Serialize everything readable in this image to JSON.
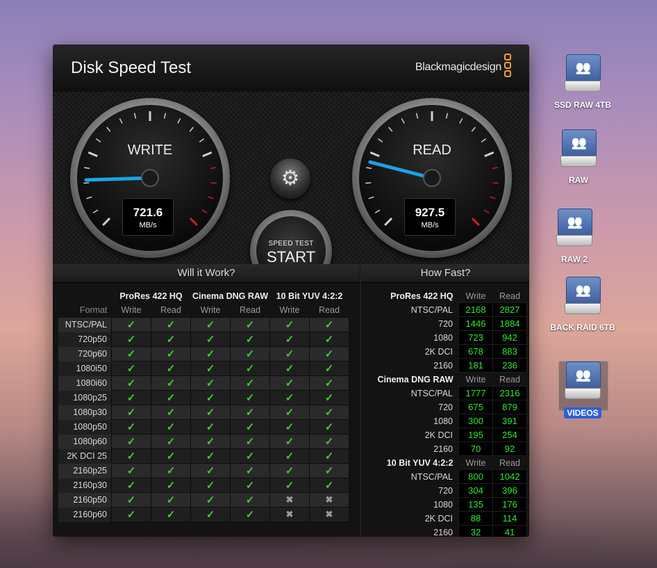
{
  "window": {
    "close_glyph": "×",
    "title": "Disk Speed Test",
    "brand": "Blackmagicdesign",
    "brand_color": "#f2a03a"
  },
  "gauges": {
    "write": {
      "label": "WRITE",
      "value": "721.6",
      "unit": "MB/s",
      "needle_level": 0.16
    },
    "read": {
      "label": "READ",
      "value": "927.5",
      "unit": "MB/s",
      "needle_level": 0.22
    }
  },
  "controls": {
    "settings_icon": "gear-icon",
    "start_line1": "SPEED TEST",
    "start_line2": "START"
  },
  "will_it_work": {
    "title": "Will it Work?",
    "format_header": "Format",
    "groups": [
      "ProRes 422 HQ",
      "Cinema DNG RAW",
      "10 Bit YUV 4:2:2"
    ],
    "sub_headers": [
      "Write",
      "Read",
      "Write",
      "Read",
      "Write",
      "Read"
    ],
    "rows": [
      {
        "format": "NTSC/PAL",
        "cells": [
          1,
          1,
          1,
          1,
          1,
          1
        ]
      },
      {
        "format": "720p50",
        "cells": [
          1,
          1,
          1,
          1,
          1,
          1
        ]
      },
      {
        "format": "720p60",
        "cells": [
          1,
          1,
          1,
          1,
          1,
          1
        ]
      },
      {
        "format": "1080i50",
        "cells": [
          1,
          1,
          1,
          1,
          1,
          1
        ]
      },
      {
        "format": "1080i60",
        "cells": [
          1,
          1,
          1,
          1,
          1,
          1
        ]
      },
      {
        "format": "1080p25",
        "cells": [
          1,
          1,
          1,
          1,
          1,
          1
        ]
      },
      {
        "format": "1080p30",
        "cells": [
          1,
          1,
          1,
          1,
          1,
          1
        ]
      },
      {
        "format": "1080p50",
        "cells": [
          1,
          1,
          1,
          1,
          1,
          1
        ]
      },
      {
        "format": "1080p60",
        "cells": [
          1,
          1,
          1,
          1,
          1,
          1
        ]
      },
      {
        "format": "2K DCI 25",
        "cells": [
          1,
          1,
          1,
          1,
          1,
          1
        ]
      },
      {
        "format": "2160p25",
        "cells": [
          1,
          1,
          1,
          1,
          1,
          1
        ]
      },
      {
        "format": "2160p30",
        "cells": [
          1,
          1,
          1,
          1,
          1,
          1
        ]
      },
      {
        "format": "2160p50",
        "cells": [
          1,
          1,
          1,
          1,
          0,
          0
        ]
      },
      {
        "format": "2160p60",
        "cells": [
          1,
          1,
          1,
          1,
          0,
          0
        ]
      }
    ],
    "check_glyph": "✓",
    "cross_glyph": "✖"
  },
  "how_fast": {
    "title": "How Fast?",
    "col_write": "Write",
    "col_read": "Read",
    "groups": [
      {
        "name": "ProRes 422 HQ",
        "rows": [
          {
            "format": "NTSC/PAL",
            "write": "2168",
            "read": "2827"
          },
          {
            "format": "720",
            "write": "1446",
            "read": "1884"
          },
          {
            "format": "1080",
            "write": "723",
            "read": "942"
          },
          {
            "format": "2K DCI",
            "write": "678",
            "read": "883"
          },
          {
            "format": "2160",
            "write": "181",
            "read": "236"
          }
        ]
      },
      {
        "name": "Cinema DNG RAW",
        "rows": [
          {
            "format": "NTSC/PAL",
            "write": "1777",
            "read": "2316"
          },
          {
            "format": "720",
            "write": "675",
            "read": "879"
          },
          {
            "format": "1080",
            "write": "300",
            "read": "391"
          },
          {
            "format": "2K DCI",
            "write": "195",
            "read": "254"
          },
          {
            "format": "2160",
            "write": "70",
            "read": "92"
          }
        ]
      },
      {
        "name": "10 Bit YUV 4:2:2",
        "rows": [
          {
            "format": "NTSC/PAL",
            "write": "800",
            "read": "1042"
          },
          {
            "format": "720",
            "write": "304",
            "read": "396"
          },
          {
            "format": "1080",
            "write": "135",
            "read": "176"
          },
          {
            "format": "2K DCI",
            "write": "88",
            "read": "114"
          },
          {
            "format": "2160",
            "write": "32",
            "read": "41"
          }
        ]
      }
    ]
  },
  "desktop_icons": [
    {
      "label": "SSD RAW 4TB",
      "icon": "network-drive-icon",
      "selected": false
    },
    {
      "label": "RAW",
      "icon": "network-drive-icon",
      "selected": false
    },
    {
      "label": "RAW 2",
      "icon": "network-drive-icon",
      "selected": false
    },
    {
      "label": "BACK RAID 6TB",
      "icon": "network-drive-icon",
      "selected": false
    },
    {
      "label": "VIDEOS",
      "icon": "network-drive-icon",
      "selected": true
    }
  ]
}
